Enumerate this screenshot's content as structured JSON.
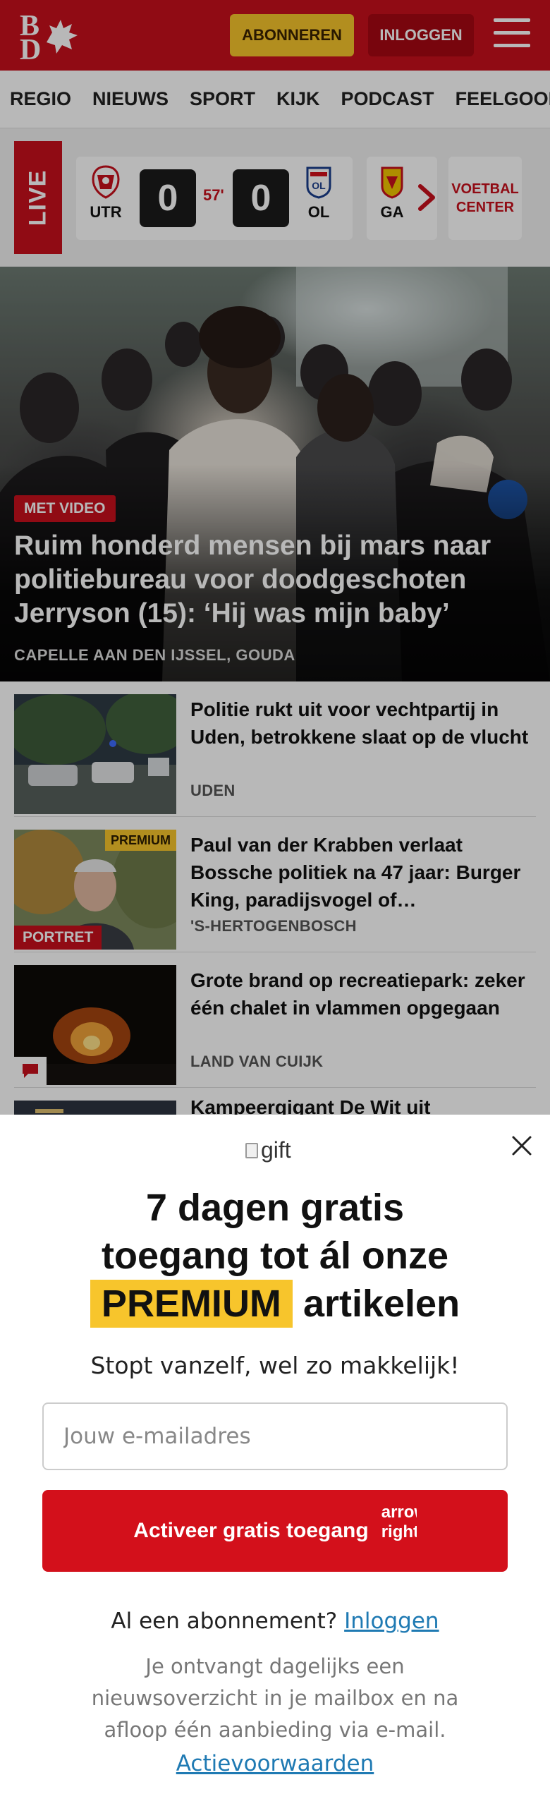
{
  "header": {
    "logo_line1": "B",
    "logo_line2": "D",
    "subscribe_label": "ABONNEREN",
    "login_label": "INLOGGEN",
    "brand_color": "#c8101c"
  },
  "nav": {
    "items": [
      "REGIO",
      "NIEUWS",
      "SPORT",
      "KIJK",
      "PODCAST",
      "FEELGOOD",
      "I"
    ]
  },
  "live": {
    "label": "LIVE",
    "match": {
      "home": "UTR",
      "away": "OL",
      "home_score": "0",
      "away_score": "0",
      "minute": "57'"
    },
    "next_team": "GA",
    "center_label": "VOETBAL CENTER"
  },
  "hero": {
    "badge": "MET VIDEO",
    "title": "Ruim honderd mensen bij mars naar politiebureau voor doodgeschoten Jerryson (15): ‘Hij was mijn baby’",
    "location": "CAPELLE AAN DEN IJSSEL, GOUDA"
  },
  "articles": [
    {
      "title": "Politie rukt uit voor vechtpartij in Uden, betrokkene slaat op de vlucht",
      "location": "UDEN"
    },
    {
      "title": "Paul van der Krabben verlaat Bossche politiek na 47 jaar: Burger King, paradijsvogel of…",
      "location": "'S-HERTOGENBOSCH",
      "premium": "PREMIUM",
      "tag": "PORTRET"
    },
    {
      "title": "Grote brand op recreatiepark: zeker één chalet in vlammen opgegaan",
      "location": "LAND VAN CUIJK"
    },
    {
      "title": "Kampeergigant De Wit uit"
    }
  ],
  "modal": {
    "gift_alt": "gift",
    "headline_1": "7 dagen gratis",
    "headline_2": "toegang tot ál onze",
    "headline_premium": "PREMIUM",
    "headline_3": "artikelen",
    "subtitle": "Stopt vanzelf, wel zo makkelijk!",
    "email_placeholder": "Jouw e-mailadres",
    "activate_label": "Activeer gratis toegang",
    "arrow_alt": "arrow right",
    "already_text": "Al een abonnement?",
    "login_link": "Inloggen",
    "info_text": "Je ontvangt dagelijks een nieuwsoverzicht in je mailbox en na afloop één aanbieding via e-mail.",
    "terms_link": "Actievoorwaarden"
  }
}
